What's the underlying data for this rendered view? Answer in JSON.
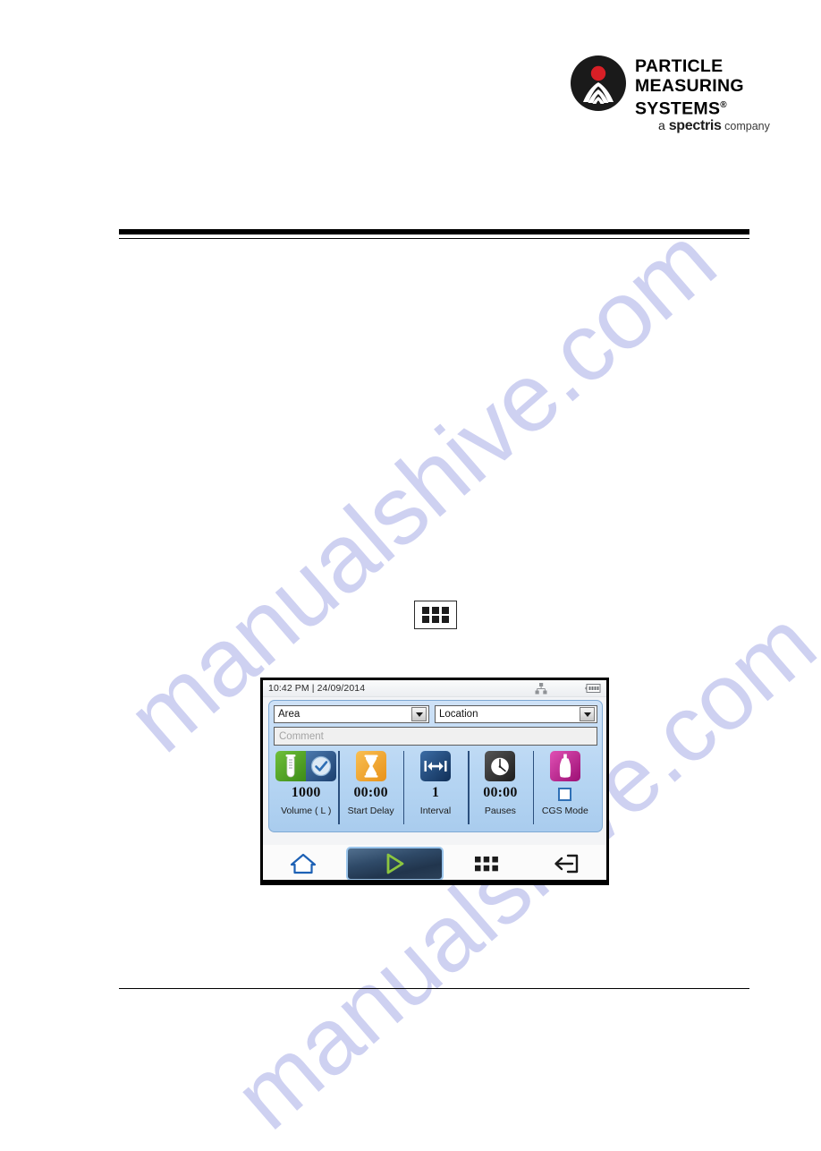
{
  "page": {
    "watermark": "manualshive.com",
    "watermark_faint": "manualshive.com"
  },
  "logo": {
    "line1": "PARTICLE",
    "line2": "MEASURING",
    "line3": "SYSTEMS",
    "registered": "®",
    "tagline_prefix": "a ",
    "tagline_brand": "spectris",
    "tagline_suffix": " company",
    "mark_name": "particle-measuring-systems-logo"
  },
  "device": {
    "status_bar": {
      "time": "10:42 PM",
      "separator": "|",
      "date": "24/09/2014",
      "timestamp": "10:42 PM | 24/09/2014",
      "icons": [
        "network-icon",
        "battery-icon"
      ]
    },
    "fields": {
      "area": {
        "label": "Area",
        "placeholder": "Area"
      },
      "location": {
        "label": "Location",
        "placeholder": "Location"
      },
      "comment": {
        "value": "",
        "placeholder": "Comment"
      }
    },
    "tiles": [
      {
        "id": "volume",
        "value": "1000",
        "label": "Volume ( L )",
        "icon": "test-tube-icon",
        "icon2": "clock-check-icon",
        "dual": true
      },
      {
        "id": "start-delay",
        "value": "00:00",
        "label": "Start Delay",
        "icon": "hourglass-icon",
        "dual": false
      },
      {
        "id": "interval",
        "value": "1",
        "label": "Interval",
        "icon": "interval-arrows-icon",
        "dual": false
      },
      {
        "id": "pauses",
        "value": "00:00",
        "label": "Pauses",
        "icon": "stopwatch-icon",
        "dual": false
      },
      {
        "id": "cgs-mode",
        "value": "",
        "label": "CGS Mode",
        "icon": "gas-bottle-icon",
        "dual": false,
        "checkbox": true,
        "checked": false
      }
    ],
    "nav": [
      {
        "id": "home",
        "icon": "home-icon",
        "label": "Home"
      },
      {
        "id": "start",
        "icon": "play-icon",
        "label": "Start"
      },
      {
        "id": "menu",
        "icon": "grid-menu-icon",
        "label": "Menu"
      },
      {
        "id": "exit",
        "icon": "exit-icon",
        "label": "Exit"
      }
    ]
  },
  "inline_icon": {
    "name": "grid-menu-icon",
    "label": "Menu"
  },
  "colors": {
    "brand_red": "#d81f26",
    "brand_black": "#1a1a1a",
    "panel_blue": "#b7d6f3",
    "accent_green": "#8cc63f",
    "watermark": "#c6c9ef"
  }
}
